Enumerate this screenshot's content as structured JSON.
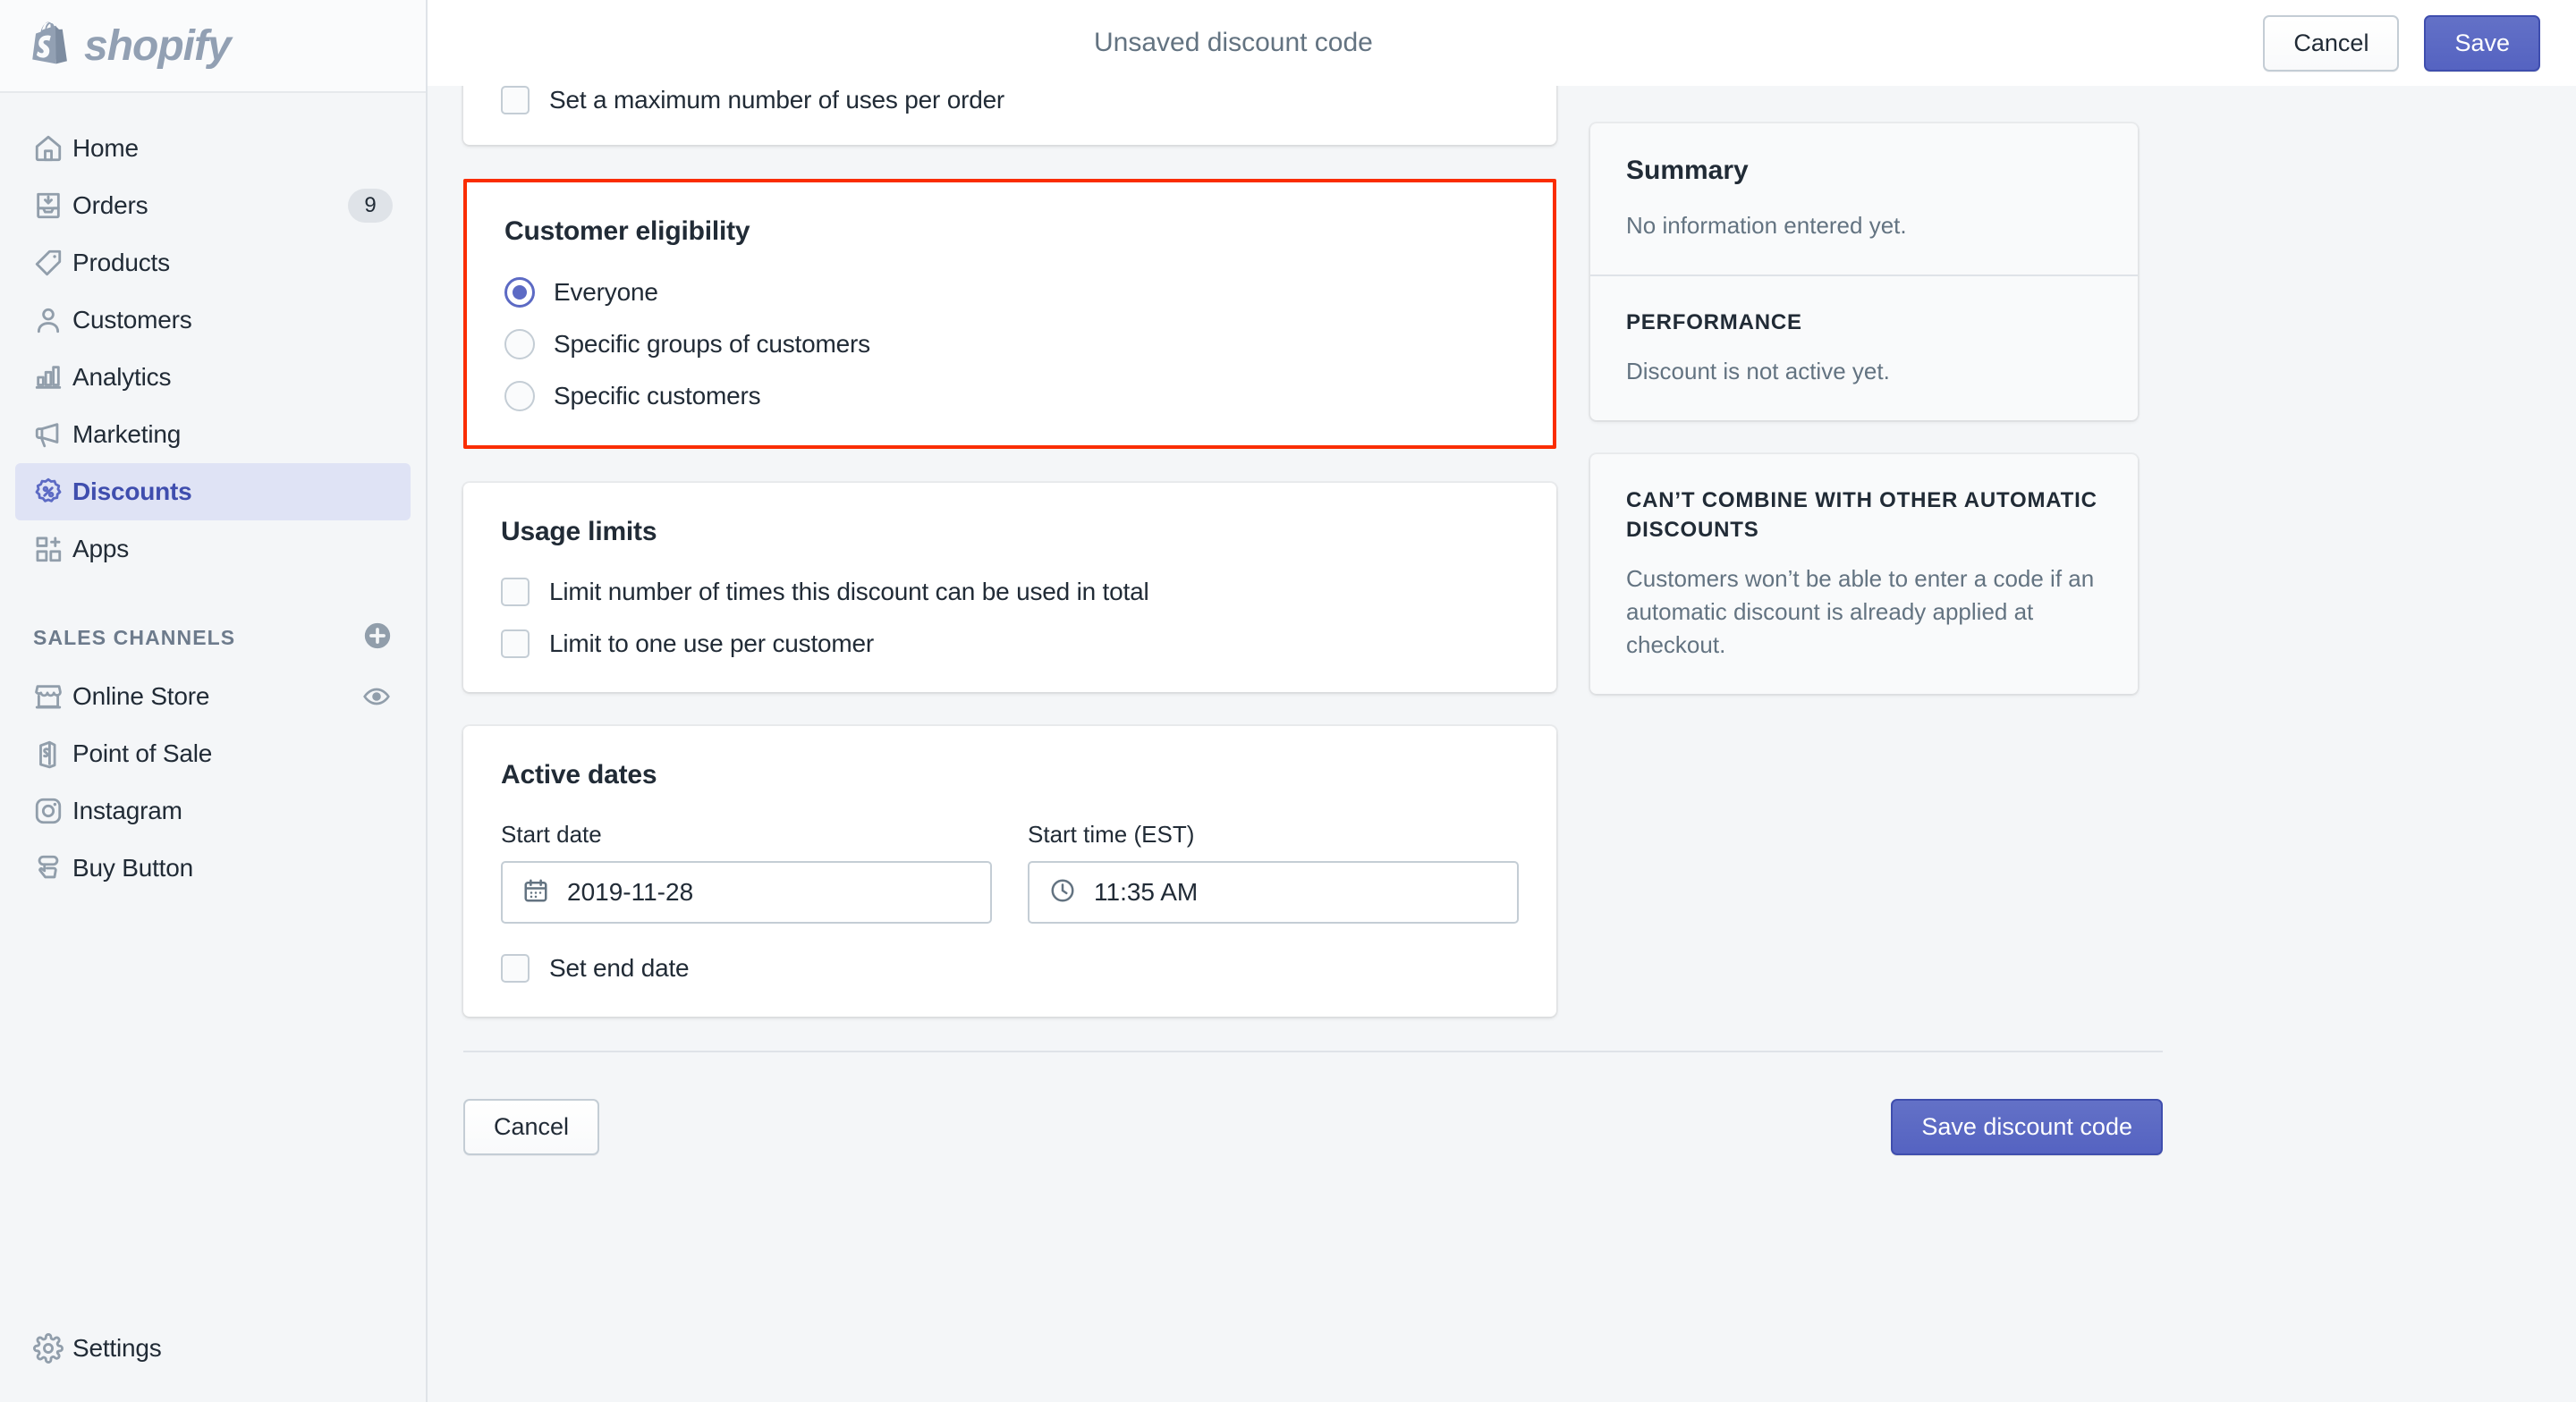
{
  "brand": {
    "name": "shopify",
    "accent": "#5c6ac4",
    "highlight": "#fa2d00"
  },
  "sidebar": {
    "primary": [
      {
        "label": "Home",
        "icon": "home-icon",
        "badge": null
      },
      {
        "label": "Orders",
        "icon": "orders-inbox-icon",
        "badge": "9"
      },
      {
        "label": "Products",
        "icon": "tag-icon",
        "badge": null
      },
      {
        "label": "Customers",
        "icon": "person-icon",
        "badge": null
      },
      {
        "label": "Analytics",
        "icon": "bar-chart-icon",
        "badge": null
      },
      {
        "label": "Marketing",
        "icon": "megaphone-icon",
        "badge": null
      },
      {
        "label": "Discounts",
        "icon": "discount-badge-icon",
        "badge": null
      },
      {
        "label": "Apps",
        "icon": "apps-grid-plus-icon",
        "badge": null
      }
    ],
    "active_item": "Discounts",
    "sales_channels_header": "SALES CHANNELS",
    "channels": [
      {
        "label": "Online Store",
        "icon": "storefront-icon",
        "trailing_icon": "eye-icon"
      },
      {
        "label": "Point of Sale",
        "icon": "shopify-bag-icon",
        "trailing_icon": null
      },
      {
        "label": "Instagram",
        "icon": "instagram-icon",
        "trailing_icon": null
      },
      {
        "label": "Buy Button",
        "icon": "buy-button-icon",
        "trailing_icon": null
      }
    ],
    "settings": {
      "label": "Settings",
      "icon": "gear-icon"
    }
  },
  "topbar": {
    "title": "Unsaved discount code",
    "cancel_label": "Cancel",
    "save_label": "Save"
  },
  "main": {
    "max_uses_card": {
      "checkbox_label": "Set a maximum number of uses per order"
    },
    "customer_eligibility": {
      "title": "Customer eligibility",
      "options": [
        {
          "label": "Everyone",
          "selected": true
        },
        {
          "label": "Specific groups of customers",
          "selected": false
        },
        {
          "label": "Specific customers",
          "selected": false
        }
      ]
    },
    "usage_limits": {
      "title": "Usage limits",
      "options": [
        {
          "label": "Limit number of times this discount can be used in total",
          "checked": false
        },
        {
          "label": "Limit to one use per customer",
          "checked": false
        }
      ]
    },
    "active_dates": {
      "title": "Active dates",
      "start_date_label": "Start date",
      "start_date_value": "2019-11-28",
      "start_date_icon": "calendar-icon",
      "start_time_label": "Start time (EST)",
      "start_time_value": "11:35 AM",
      "start_time_icon": "clock-icon",
      "end_date_checkbox_label": "Set end date"
    },
    "footer": {
      "cancel_label": "Cancel",
      "save_label": "Save discount code"
    }
  },
  "aside": {
    "summary": {
      "title": "Summary",
      "body": "No information entered yet.",
      "performance_heading": "PERFORMANCE",
      "performance_body": "Discount is not active yet."
    },
    "combine_note": {
      "heading": "CAN’T COMBINE WITH OTHER AUTOMATIC DISCOUNTS",
      "body": "Customers won’t be able to enter a code if an automatic discount is already applied at checkout."
    }
  }
}
